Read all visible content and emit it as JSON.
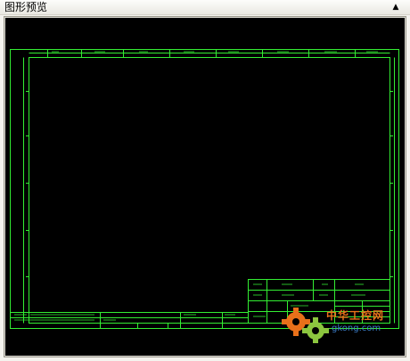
{
  "panel": {
    "title": "图形预览",
    "collapse_icon": "▲"
  },
  "drawing": {
    "line_color": "#33ee33",
    "background": "#000000"
  },
  "watermark": {
    "brand_text": "中华工控网",
    "domain": "gkong.com"
  }
}
